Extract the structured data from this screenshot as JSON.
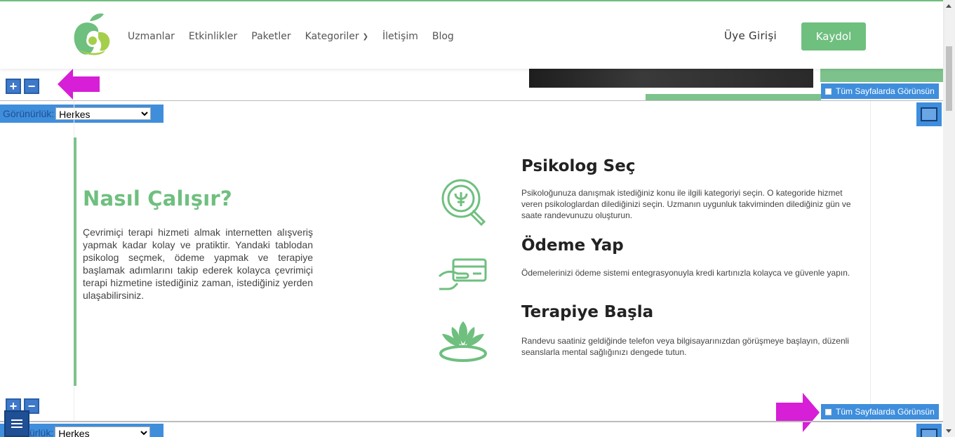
{
  "colors": {
    "brand_green": "#6fbf7f",
    "editor_blue": "#3f8edc",
    "arrow_magenta": "#d61fd6"
  },
  "header": {
    "nav": [
      "Uzmanlar",
      "Etkinlikler",
      "Paketler",
      "Kategoriler",
      "İletişim",
      "Blog"
    ],
    "login_label": "Üye Girişi",
    "signup_label": "Kaydol"
  },
  "editor": {
    "zoom_in_label": "+",
    "zoom_out_label": "−",
    "visibility_label": "Görünürlük:",
    "visibility_value": "Herkes",
    "all_pages_label": "Tüm Sayfalarda Görünsün",
    "bottom_visibility_label": "ürlük:"
  },
  "section": {
    "title": "Nasıl Çalışır?",
    "description": "Çevrimiçi terapi hizmeti almak internetten alışveriş yapmak kadar kolay ve pratiktir. Yandaki tablodan psikolog seçmek, ödeme yapmak ve terapiye başlamak adımlarını takip ederek kolayca çevrimiçi terapi hizmetine istediğiniz zaman, istediğiniz yerden ulaşabilirsiniz.",
    "steps": [
      {
        "icon": "psychology-search-icon",
        "title": "Psikolog Seç",
        "text": "Psikoloğunuza danışmak istediğiniz konu ile ilgili kategoriyi seçin. O kategoride hizmet veren psikologlardan dilediğinizi seçin. Uzmanın uygunluk takviminden dilediğiniz gün ve saate randevunuzu oluşturun."
      },
      {
        "icon": "card-payment-icon",
        "title": "Ödeme Yap",
        "text": "Ödemelerinizi ödeme sistemi entegrasyonuyla kredi kartınızla kolayca ve güvenle yapın."
      },
      {
        "icon": "lotus-icon",
        "title": "Terapiye Başla",
        "text": "Randevu saatiniz geldiğinde telefon veya bilgisayarınızdan görüşmeye başlayın, düzenli seanslarla mental sağlığınızı dengede tutun."
      }
    ]
  }
}
